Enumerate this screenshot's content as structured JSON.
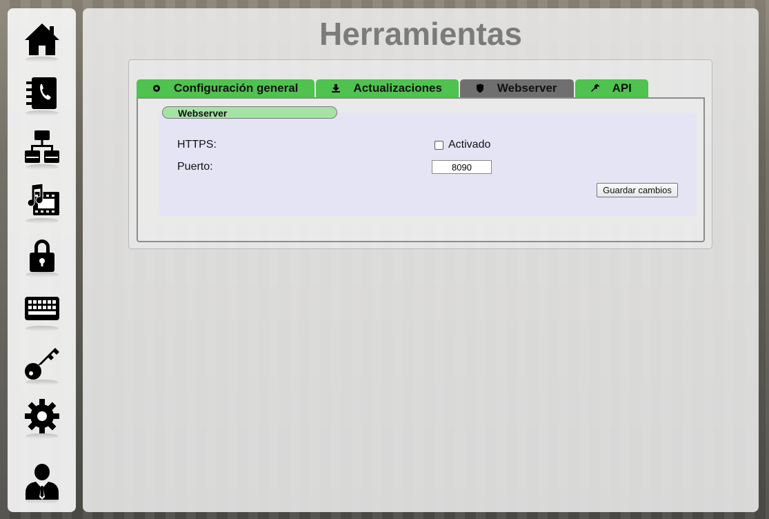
{
  "page": {
    "title": "Herramientas"
  },
  "sidebar": {
    "items": [
      {
        "icon": "home-icon",
        "name": "home"
      },
      {
        "icon": "phonebook-icon",
        "name": "contacts"
      },
      {
        "icon": "network-icon",
        "name": "network"
      },
      {
        "icon": "multimedia-icon",
        "name": "multimedia"
      },
      {
        "icon": "lock-icon",
        "name": "security"
      },
      {
        "icon": "keyboard-icon",
        "name": "keyboard"
      },
      {
        "icon": "key-icon",
        "name": "keys"
      },
      {
        "icon": "gear-icon",
        "name": "settings"
      },
      {
        "icon": "user-icon",
        "name": "user"
      }
    ]
  },
  "tabs": [
    {
      "label": "Configuración general",
      "icon": "gear-small-icon",
      "active": false
    },
    {
      "label": "Actualizaciones",
      "icon": "download-icon",
      "active": false
    },
    {
      "label": "Webserver",
      "icon": "shield-icon",
      "active": true
    },
    {
      "label": "API",
      "icon": "wrench-icon",
      "active": false
    }
  ],
  "webserver": {
    "section_title": "Webserver",
    "https_label": "HTTPS:",
    "https_checkbox_label": "Activado",
    "https_enabled": false,
    "port_label": "Puerto:",
    "port_value": "8090",
    "save_label": "Guardar cambios"
  },
  "colors": {
    "tab_green": "#4fc24f",
    "tab_active": "#6f6f6f",
    "section_pill": "#a4e3a4",
    "title_gray": "#7b7b7b"
  }
}
